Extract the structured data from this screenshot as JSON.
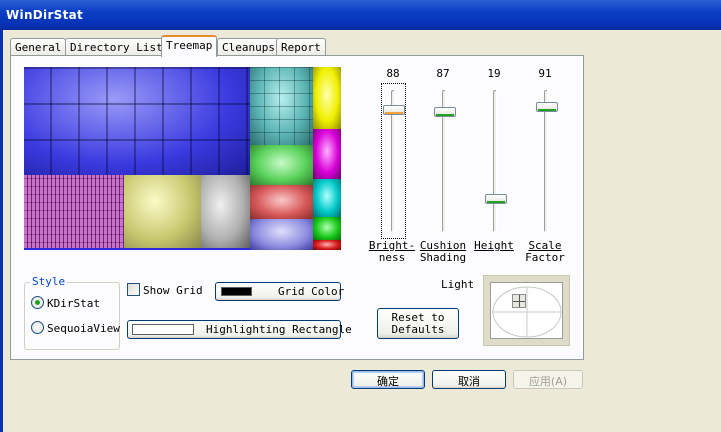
{
  "window": {
    "title": "WinDirStat"
  },
  "tabs": [
    {
      "label": "General"
    },
    {
      "label": "Directory List"
    },
    {
      "label": "Treemap"
    },
    {
      "label": "Cleanups"
    },
    {
      "label": "Report"
    }
  ],
  "sliders": {
    "brightness": {
      "value": "88",
      "label_line1": "Bright-",
      "label_line2": "ness"
    },
    "cushion_shading": {
      "value": "87",
      "label_line1": "Cushion",
      "label_line2": "Shading"
    },
    "height": {
      "value": "19",
      "label_line1": "Height",
      "label_line2": ""
    },
    "scale_factor": {
      "value": "91",
      "label_line1": "Scale",
      "label_line2": "Factor"
    }
  },
  "style_group": {
    "title": "Style",
    "options": [
      {
        "label": "KDirStat",
        "selected": true
      },
      {
        "label": "SequoiaView",
        "selected": false
      }
    ]
  },
  "show_grid": {
    "label": "Show Grid",
    "checked": false
  },
  "grid_color": {
    "label": "Grid Color",
    "color": "#000000"
  },
  "highlight_rect": {
    "label": "Highlighting Rectangle",
    "color": "#ffffff"
  },
  "reset": {
    "line1": "Reset to",
    "line2": "Defaults"
  },
  "light": {
    "label": "Light"
  },
  "dialog_buttons": {
    "ok": "确定",
    "cancel": "取消",
    "apply": "应用(A)"
  },
  "colors": {
    "blue": "#3a3ae0",
    "purple": "#b84ab8",
    "olive": "#c8c870",
    "gray": "#b0b0b0",
    "teal": "#5cb4b4",
    "green": "#5ad25a",
    "red": "#d85a5a",
    "yellow": "#f0f000",
    "magenta": "#d800d8",
    "cyan": "#00c8c8",
    "accent_orange": "#e68b2c",
    "titlebar_blue": "#0a3ec4"
  }
}
